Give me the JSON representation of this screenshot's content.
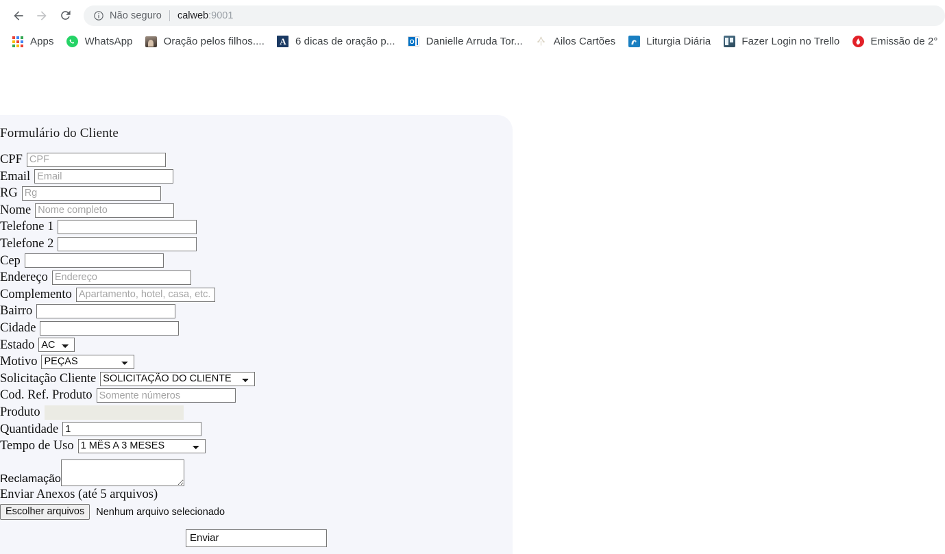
{
  "browser": {
    "nav": {
      "back_title": "Voltar",
      "forward_title": "Avançar",
      "reload_title": "Recarregar"
    },
    "omnibox": {
      "security_label": "Não seguro",
      "url_host": "calweb",
      "url_port": ":9001"
    },
    "bookmarks": [
      {
        "label": "Apps",
        "icon": "apps-grid-icon"
      },
      {
        "label": "WhatsApp",
        "icon": "whatsapp-icon"
      },
      {
        "label": "Oração pelos filhos....",
        "icon": "photo-icon"
      },
      {
        "label": "6 dicas de oração p...",
        "icon": "letter-a-icon"
      },
      {
        "label": "Danielle Arruda Tor...",
        "icon": "outlook-icon"
      },
      {
        "label": "Ailos Cartões",
        "icon": "ailos-icon"
      },
      {
        "label": "Liturgia Diária",
        "icon": "liturgia-icon"
      },
      {
        "label": "Fazer Login no Trello",
        "icon": "trello-icon"
      },
      {
        "label": "Emissão de 2°",
        "icon": "red-drop-icon"
      }
    ]
  },
  "form": {
    "title": "Formulário do Cliente",
    "fields": {
      "cpf": {
        "label": "CPF",
        "placeholder": "CPF",
        "value": ""
      },
      "email": {
        "label": "Email",
        "placeholder": "Email",
        "value": ""
      },
      "rg": {
        "label": "RG",
        "placeholder": "Rg",
        "value": ""
      },
      "nome": {
        "label": "Nome",
        "placeholder": "Nome completo",
        "value": ""
      },
      "telefone1": {
        "label": "Telefone 1",
        "placeholder": "",
        "value": ""
      },
      "telefone2": {
        "label": "Telefone 2",
        "placeholder": "",
        "value": ""
      },
      "cep": {
        "label": "Cep",
        "placeholder": "",
        "value": ""
      },
      "endereco": {
        "label": "Endereço",
        "placeholder": "Endereço",
        "value": ""
      },
      "complemento": {
        "label": "Complemento",
        "placeholder": "Apartamento, hotel, casa, etc.",
        "value": ""
      },
      "bairro": {
        "label": "Bairro",
        "placeholder": "",
        "value": ""
      },
      "cidade": {
        "label": "Cidade",
        "placeholder": "",
        "value": ""
      },
      "estado": {
        "label": "Estado",
        "selected": "AC"
      },
      "motivo": {
        "label": "Motivo",
        "selected": "PEÇAS"
      },
      "solicitacao": {
        "label": "Solicitação Cliente",
        "selected": "SOLICITAÇÃO DO CLIENTE"
      },
      "cod_ref": {
        "label": "Cod. Ref. Produto",
        "placeholder": "Somente números",
        "value": ""
      },
      "produto": {
        "label": "Produto",
        "placeholder": "",
        "value": ""
      },
      "quantidade": {
        "label": "Quantidade",
        "placeholder": "",
        "value": "1"
      },
      "tempo_uso": {
        "label": "Tempo de Uso",
        "selected": "1 MÊS A 3 MESES"
      },
      "reclamacao": {
        "label": "Reclamação",
        "value": ""
      }
    },
    "anexos": {
      "label": "Enviar Anexos (até 5 arquivos)",
      "button_label": "Escolher arquivos",
      "status": "Nenhum arquivo selecionado"
    },
    "submit_label": "Enviar"
  }
}
